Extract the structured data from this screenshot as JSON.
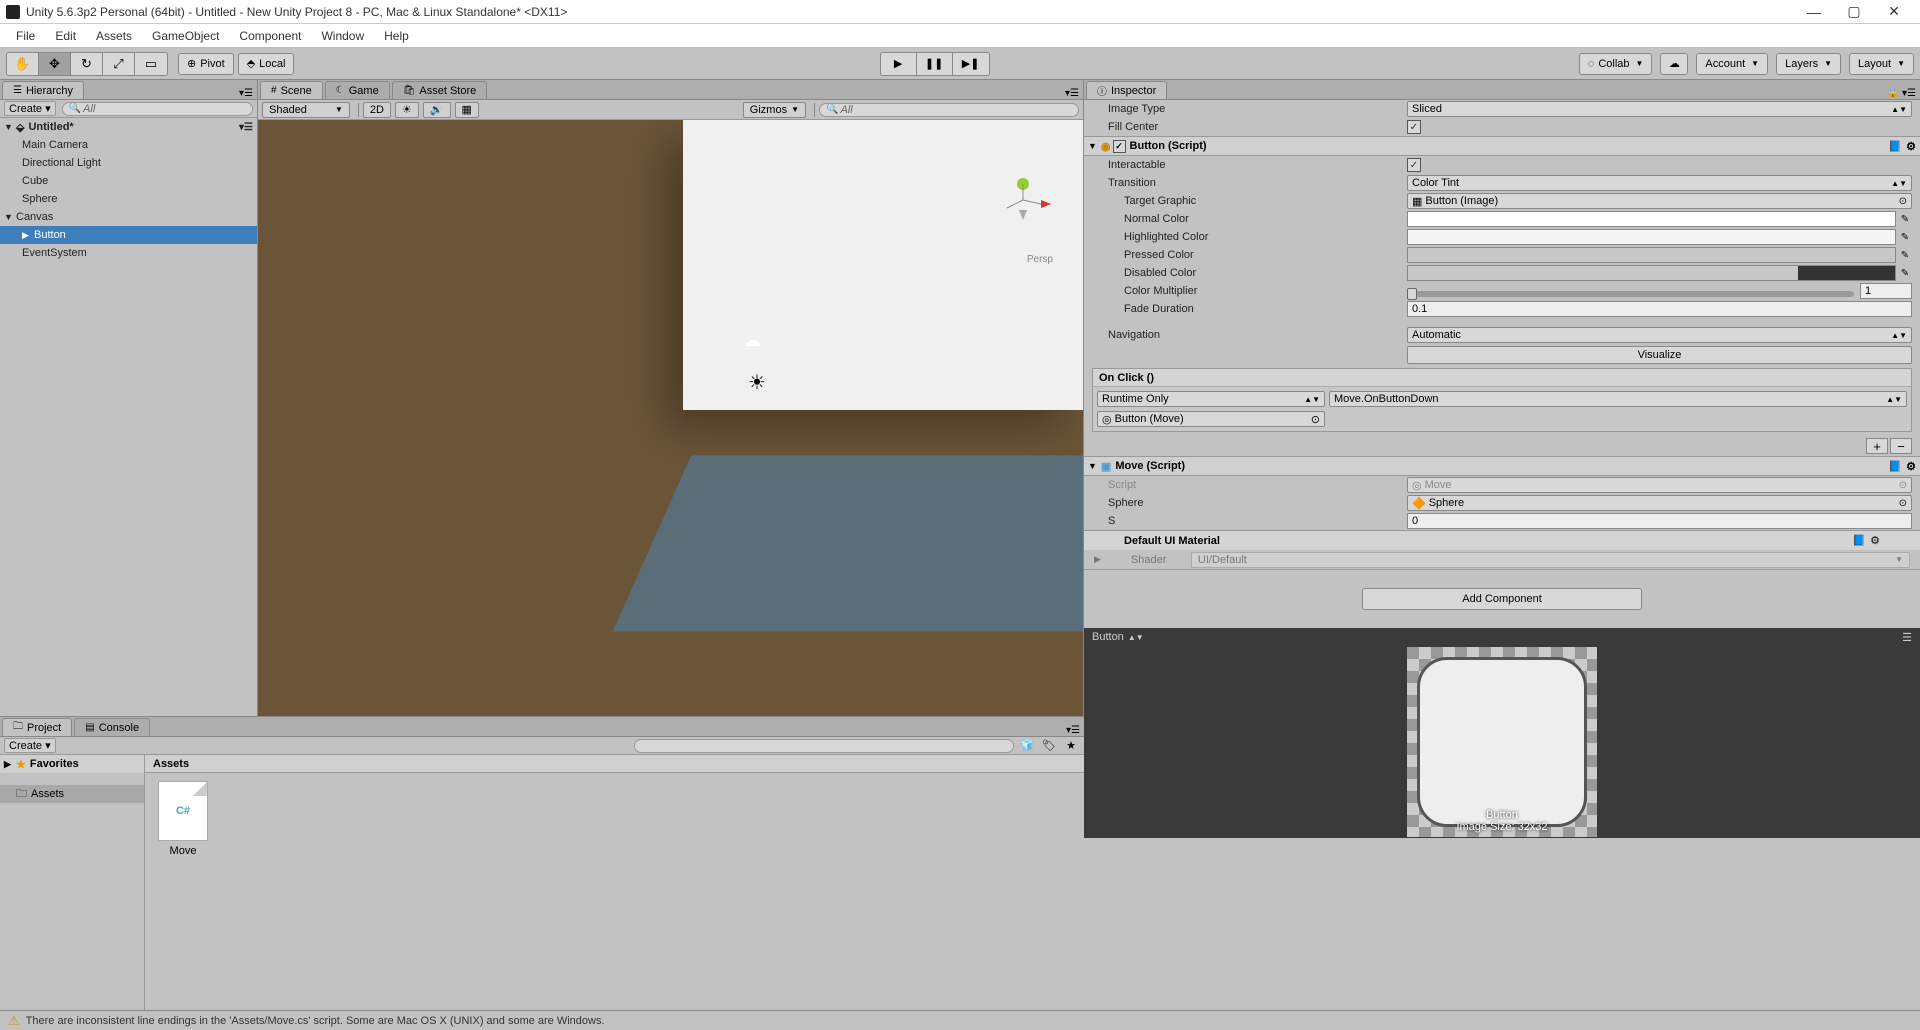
{
  "window": {
    "title": "Unity 5.6.3p2 Personal (64bit) - Untitled - New Unity Project 8 - PC, Mac & Linux Standalone* <DX11>",
    "min": "—",
    "max": "▢",
    "close": "✕"
  },
  "menu": [
    "File",
    "Edit",
    "Assets",
    "GameObject",
    "Component",
    "Window",
    "Help"
  ],
  "toolbar": {
    "pivot": "Pivot",
    "local": "Local",
    "collab": "Collab",
    "account": "Account",
    "layers": "Layers",
    "layout": "Layout"
  },
  "hierarchy": {
    "tab": "Hierarchy",
    "create": "Create ▾",
    "search": "All",
    "scene": "Untitled*",
    "items": [
      "Main Camera",
      "Directional Light",
      "Cube",
      "Sphere",
      "Canvas",
      "Button",
      "EventSystem"
    ]
  },
  "sceneTabs": {
    "scene": "Scene",
    "game": "Game",
    "asset": "Asset Store"
  },
  "sceneToolbar": {
    "shaded": "Shaded",
    "mode2d": "2D",
    "gizmos": "Gizmos",
    "search": "All",
    "persp": "Persp"
  },
  "inspector": {
    "tab": "Inspector",
    "imageType": {
      "label": "Image Type",
      "value": "Sliced"
    },
    "fillCenter": "Fill Center",
    "button": {
      "header": "Button (Script)",
      "interactable": "Interactable",
      "transition": {
        "label": "Transition",
        "value": "Color Tint"
      },
      "targetGraphic": {
        "label": "Target Graphic",
        "value": "Button (Image)"
      },
      "normalColor": "Normal Color",
      "highlightedColor": "Highlighted Color",
      "pressedColor": "Pressed Color",
      "disabledColor": "Disabled Color",
      "colorMult": {
        "label": "Color Multiplier",
        "value": "1"
      },
      "fadeDur": {
        "label": "Fade Duration",
        "value": "0.1"
      },
      "navigation": {
        "label": "Navigation",
        "value": "Automatic"
      },
      "visualize": "Visualize",
      "onclick": {
        "header": "On Click ()",
        "runtime": "Runtime Only",
        "func": "Move.OnButtonDown",
        "target": "Button (Move)"
      }
    },
    "move": {
      "header": "Move (Script)",
      "script": {
        "label": "Script",
        "value": "Move"
      },
      "sphere": {
        "label": "Sphere",
        "value": "Sphere"
      },
      "s": {
        "label": "S",
        "value": "0"
      }
    },
    "material": {
      "header": "Default UI Material",
      "shaderLabel": "Shader",
      "shaderValue": "UI/Default"
    },
    "addComponent": "Add Component",
    "preview": {
      "title": "Button",
      "caption": "Button",
      "size": "Image Size: 32x32"
    }
  },
  "project": {
    "tab": "Project",
    "consoleTab": "Console",
    "create": "Create ▾",
    "favorites": "Favorites",
    "assets": "Assets",
    "path": "Assets",
    "item": {
      "name": "Move",
      "iconText": "C#"
    }
  },
  "status": {
    "text": "There are inconsistent line endings in the 'Assets/Move.cs' script. Some are Mac OS X (UNIX) and some are Windows."
  }
}
